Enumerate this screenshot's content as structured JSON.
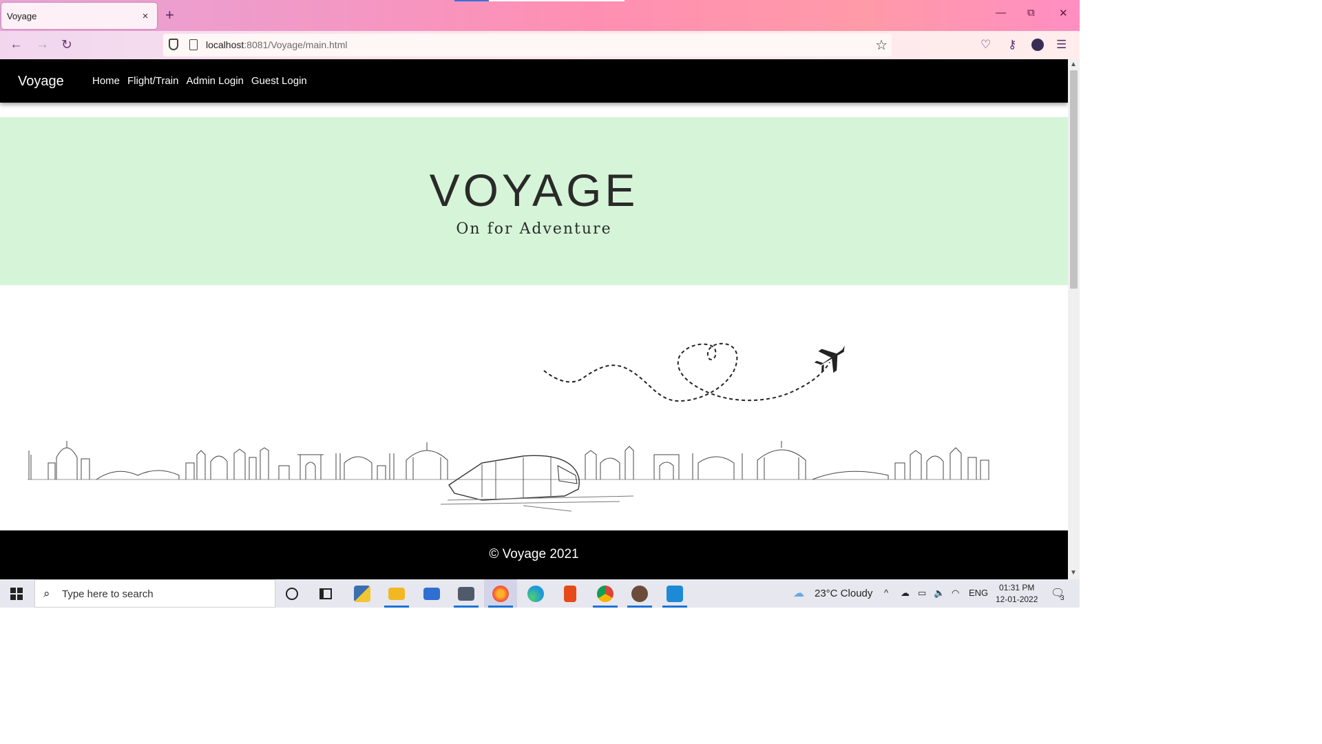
{
  "browser": {
    "tab_title": "Voyage",
    "tab_close": "×",
    "new_tab": "+",
    "url_host": "localhost",
    "url_rest": ":8081/Voyage/main.html",
    "window_controls": {
      "minimize": "—",
      "restore": "⧉",
      "close": "✕"
    },
    "nav": {
      "back": "←",
      "forward": "→",
      "reload": "↻"
    }
  },
  "site": {
    "brand": "Voyage",
    "nav_links": [
      {
        "label": "Home"
      },
      {
        "label": "Flight/Train"
      },
      {
        "label": "Admin Login"
      },
      {
        "label": "Guest Login"
      }
    ],
    "hero": {
      "title": "VOYAGE",
      "subtitle": "On for Adventure",
      "background": "#d6f5d8"
    },
    "footer": "© Voyage 2021"
  },
  "taskbar": {
    "search_placeholder": "Type here to search",
    "weather": "23°C  Cloudy",
    "language": "ENG",
    "time": "01:31 PM",
    "date": "12-01-2022",
    "notification_count": "3",
    "apps": [
      {
        "name": "cortana-icon",
        "color": "#222222"
      },
      {
        "name": "task-view-icon",
        "color": "#222222"
      },
      {
        "name": "python-icon",
        "color": "#e7b53b"
      },
      {
        "name": "file-explorer-icon",
        "color": "#f2b823"
      },
      {
        "name": "mail-icon",
        "color": "#2f6fd1"
      },
      {
        "name": "terminal-app-icon",
        "color": "#4f5a6a"
      },
      {
        "name": "firefox-icon",
        "color": "#ff6a2c"
      },
      {
        "name": "edge-icon",
        "color": "#1e9ad6"
      },
      {
        "name": "office-icon",
        "color": "#e64a19"
      },
      {
        "name": "chrome-icon",
        "color": "#3aa657"
      },
      {
        "name": "app-icon",
        "color": "#6b4c3b"
      },
      {
        "name": "vscode-icon",
        "color": "#1e8ad6"
      }
    ]
  }
}
